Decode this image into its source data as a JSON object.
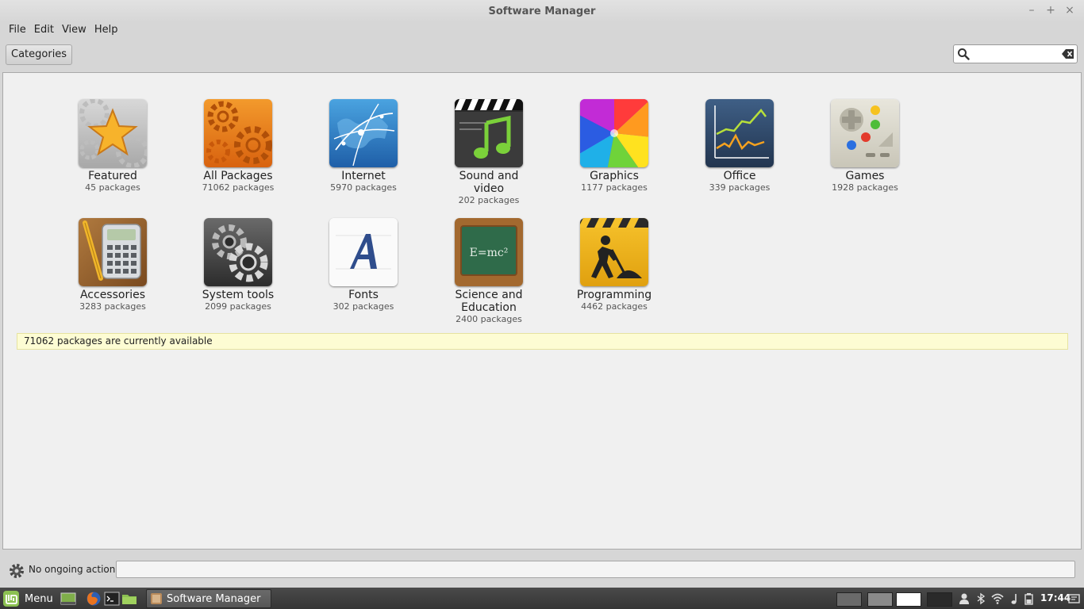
{
  "window": {
    "title": "Software Manager",
    "controls": {
      "minimize": "–",
      "maximize": "+",
      "close": "×"
    }
  },
  "menubar": {
    "items": [
      "File",
      "Edit",
      "View",
      "Help"
    ]
  },
  "toolbar": {
    "categories_label": "Categories",
    "search_value": "",
    "search_placeholder": ""
  },
  "categories": [
    {
      "name": "Featured",
      "count": "45 packages",
      "icon": "star-icon"
    },
    {
      "name": "All Packages",
      "count": "71062 packages",
      "icon": "gears-icon"
    },
    {
      "name": "Internet",
      "count": "5970 packages",
      "icon": "globe-icon"
    },
    {
      "name": "Sound and\nvideo",
      "count": "202 packages",
      "icon": "clapper-music-icon"
    },
    {
      "name": "Graphics",
      "count": "1177 packages",
      "icon": "color-wheel-icon"
    },
    {
      "name": "Office",
      "count": "339 packages",
      "icon": "chart-icon"
    },
    {
      "name": "Games",
      "count": "1928 packages",
      "icon": "gamepad-icon"
    },
    {
      "name": "Accessories",
      "count": "3283 packages",
      "icon": "calculator-icon"
    },
    {
      "name": "System tools",
      "count": "2099 packages",
      "icon": "system-gear-icon"
    },
    {
      "name": "Fonts",
      "count": "302 packages",
      "icon": "font-a-icon"
    },
    {
      "name": "Science and\nEducation",
      "count": "2400 packages",
      "icon": "chalkboard-icon"
    },
    {
      "name": "Programming",
      "count": "4462 packages",
      "icon": "construction-icon"
    }
  ],
  "info_bar": {
    "text": "71062 packages are currently available"
  },
  "statusbar": {
    "text": "No ongoing actions"
  },
  "taskbar": {
    "menu_label": "Menu",
    "task_label": "Software Manager",
    "clock": "17:44"
  },
  "colors": {
    "info_bg": "#fdfcd3",
    "mint_green": "#8cc152",
    "panel": "#3c3c3c"
  }
}
